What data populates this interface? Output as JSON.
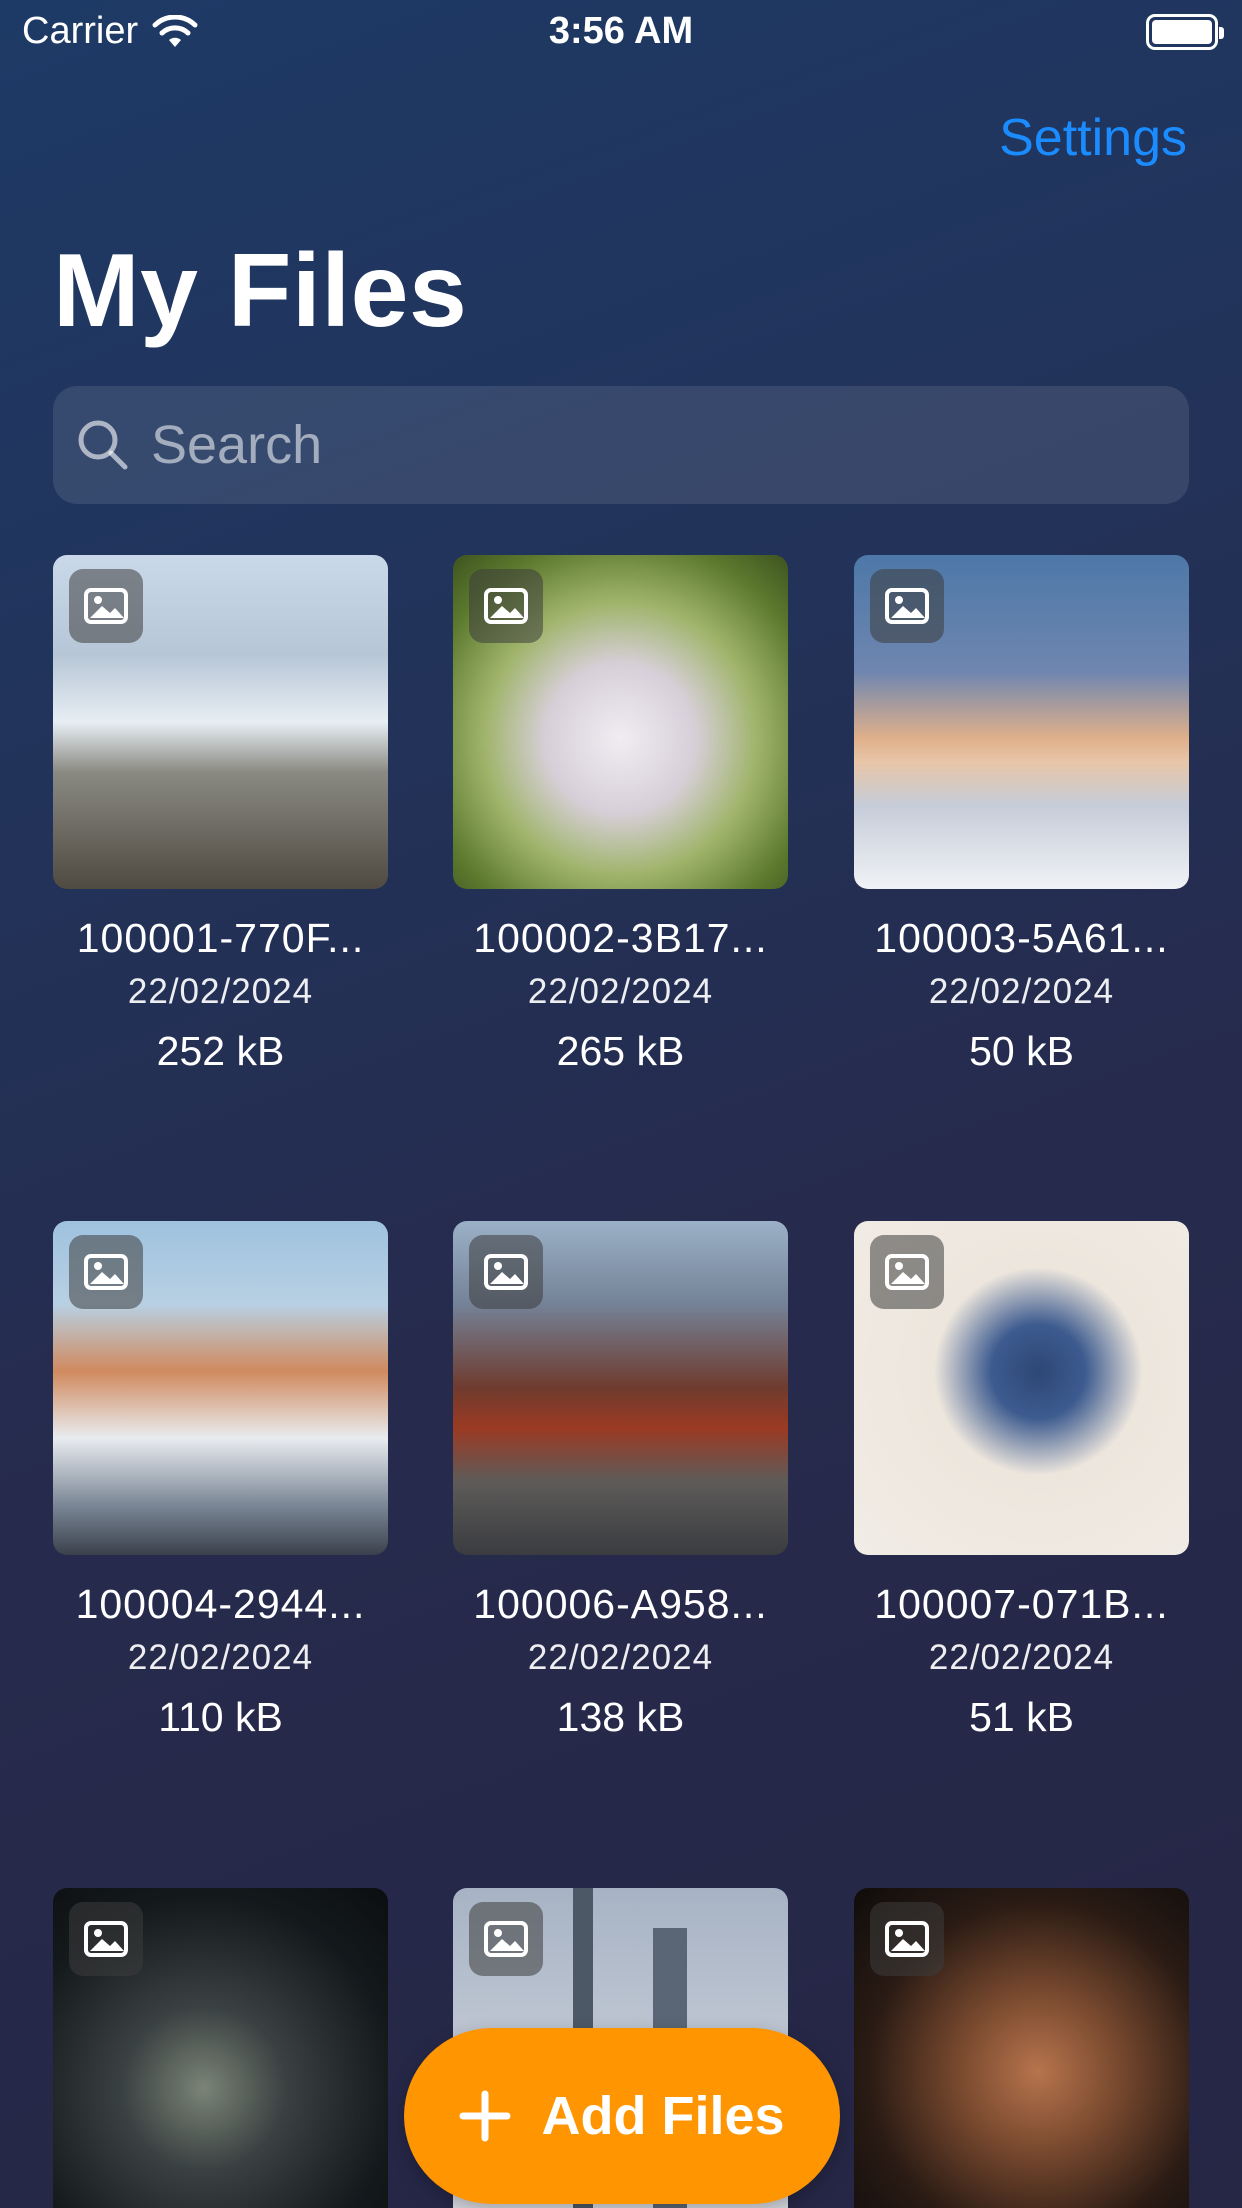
{
  "status_bar": {
    "carrier": "Carrier",
    "time": "3:56 AM"
  },
  "header": {
    "settings_label": "Settings",
    "title": "My Files"
  },
  "search": {
    "placeholder": "Search",
    "value": ""
  },
  "files": [
    {
      "name": "100001-770F...",
      "date": "22/02/2024",
      "size": "252 kB",
      "thumb_icon": "photo-icon"
    },
    {
      "name": "100002-3B17...",
      "date": "22/02/2024",
      "size": "265 kB",
      "thumb_icon": "photo-icon"
    },
    {
      "name": "100003-5A61...",
      "date": "22/02/2024",
      "size": "50 kB",
      "thumb_icon": "photo-icon"
    },
    {
      "name": "100004-2944...",
      "date": "22/02/2024",
      "size": "110 kB",
      "thumb_icon": "photo-icon"
    },
    {
      "name": "100006-A958...",
      "date": "22/02/2024",
      "size": "138 kB",
      "thumb_icon": "photo-icon"
    },
    {
      "name": "100007-071B...",
      "date": "22/02/2024",
      "size": "51 kB",
      "thumb_icon": "photo-icon"
    },
    {
      "name": "",
      "date": "",
      "size": "",
      "thumb_icon": "photo-icon"
    },
    {
      "name": "",
      "date": "",
      "size": "",
      "thumb_icon": "photo-icon"
    },
    {
      "name": "",
      "date": "",
      "size": "",
      "thumb_icon": "photo-icon"
    }
  ],
  "add_button": {
    "label": "Add Files",
    "icon": "plus-icon"
  },
  "colors": {
    "accent": "#1a8cff",
    "action": "#ff9500",
    "background": "#262a4c"
  }
}
